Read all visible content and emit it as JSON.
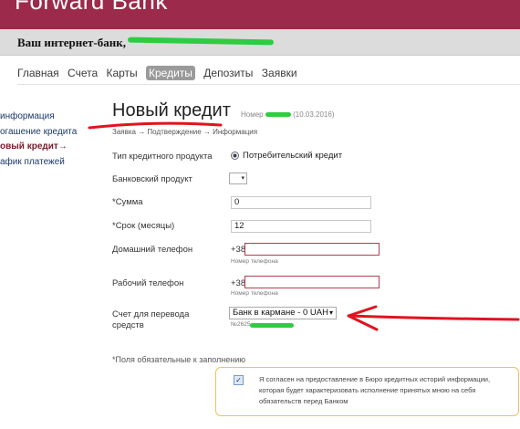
{
  "header": {
    "brand": "Forward Bank",
    "greeting": "Ваш интернет-банк,"
  },
  "nav": {
    "items": [
      "Главная",
      "Счета",
      "Карты",
      "Кредиты",
      "Депозиты",
      "Заявки"
    ]
  },
  "sidebar": {
    "items": [
      "информация",
      "огашение кредита",
      "овый кредит→",
      "афик платежей"
    ]
  },
  "page": {
    "title": "Новый кредит",
    "number_label": "Номер",
    "date": "(10.03.2016)",
    "steps": "Заявка → Подтверждение → Информация"
  },
  "form": {
    "product_type": {
      "label": "Тип кредитного продукта",
      "value": "Потребительский кредит"
    },
    "bank_product": {
      "label": "Банковский продукт",
      "value": ""
    },
    "amount": {
      "label": "*Сумма",
      "value": "0"
    },
    "term": {
      "label": "*Срок (месяцы)",
      "value": "12"
    },
    "home_phone": {
      "label": "Домашний телефон",
      "prefix": "+38",
      "value": "",
      "hint": "Номер телефона"
    },
    "work_phone": {
      "label": "Рабочий телефон",
      "prefix": "+38",
      "value": "",
      "hint": "Номер телефона"
    },
    "account": {
      "label_line1": "Счет для перевода",
      "label_line2": "средств",
      "value": "Банк в кармане - 0 UAH",
      "number": "№2625"
    }
  },
  "required_note": "*Поля обязательные к заполнению",
  "agreement": {
    "checked": true,
    "text": "Я согласен на предоставление в Бюро кредитных историй информации, которая будет характеризовать исполнение принятых мною на себя обязательств перед Банком"
  },
  "colors": {
    "header": "#9c2a4a",
    "annotation_red": "#e0141e",
    "annotation_green": "#2ecc40",
    "notice_border": "#f0c060"
  }
}
